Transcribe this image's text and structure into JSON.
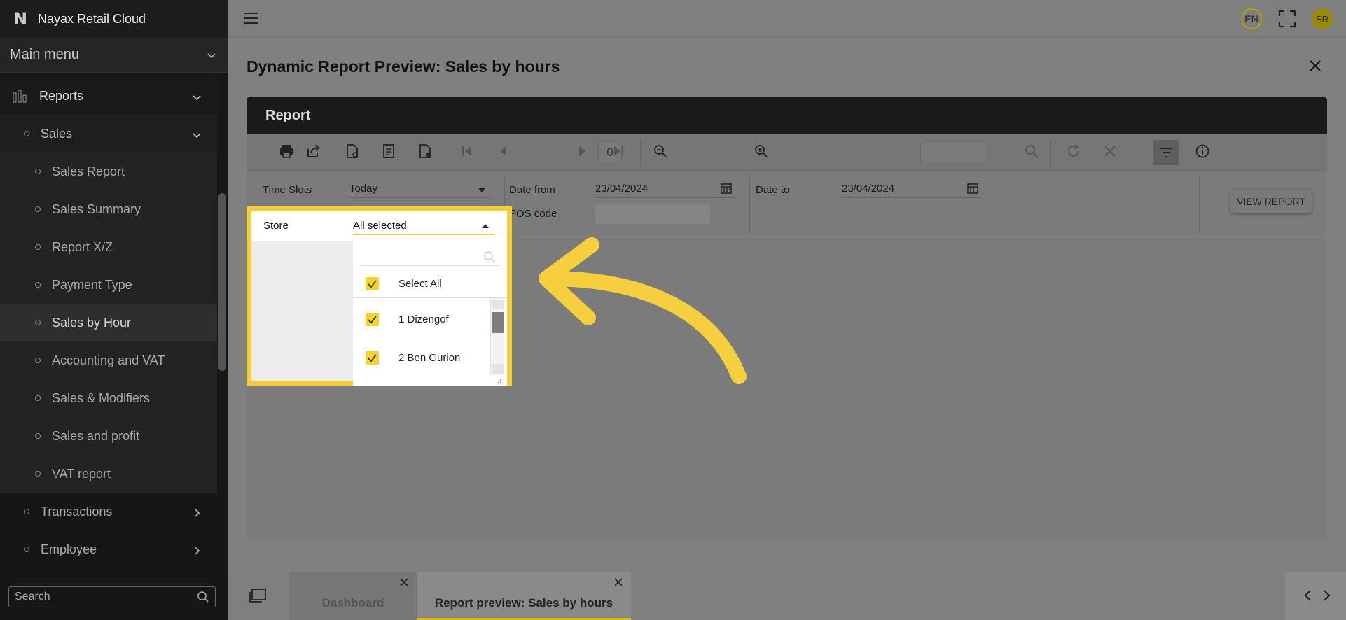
{
  "app": {
    "title": "Nayax Retail Cloud",
    "logo_letter": "N"
  },
  "sidebar": {
    "main_menu": "Main menu",
    "reports": "Reports",
    "sales": "Sales",
    "sales_items": [
      "Sales Report",
      "Sales Summary",
      "Report X/Z",
      "Payment Type",
      "Sales by Hour",
      "Accounting and VAT",
      "Sales & Modifiers",
      "Sales and profit",
      "VAT report"
    ],
    "active_item": "Sales by Hour",
    "transactions": "Transactions",
    "employee": "Employee",
    "search_placeholder": "Search"
  },
  "topbar": {
    "language": "EN",
    "user_initials": "SR"
  },
  "page": {
    "title": "Dynamic Report Preview: Sales by hours"
  },
  "report": {
    "header": "Report",
    "page_number": "0",
    "params": {
      "time_slots_label": "Time Slots",
      "time_slots_value": "Today",
      "date_from_label": "Date from",
      "date_from_value": "23/04/2024",
      "date_to_label": "Date to",
      "date_to_value": "23/04/2024",
      "store_label": "Store",
      "store_value": "All selected",
      "pos_code_label": "POS code",
      "view_report": "VIEW REPORT"
    },
    "store_dropdown": {
      "select_all": "Select All",
      "items": [
        "1 Dizengof",
        "2 Ben Gurion"
      ]
    }
  },
  "bottom_tabs": [
    {
      "label": "Dashboard"
    },
    {
      "label": "Report preview: Sales by hours"
    }
  ],
  "colors": {
    "accent": "#f4ce38",
    "sidebar_bg": "#161616"
  }
}
